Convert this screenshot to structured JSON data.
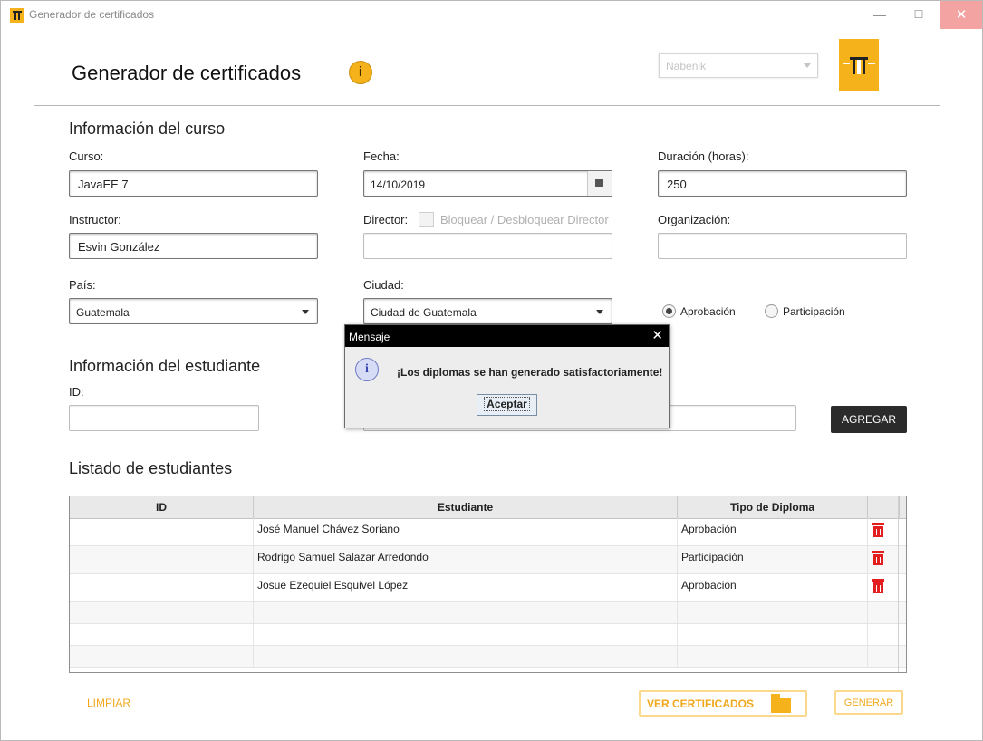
{
  "window": {
    "title": "Generador de certificados",
    "minimize": "—",
    "maximize": "☐",
    "close": "✕"
  },
  "header": {
    "title": "Generador de certificados",
    "info_icon": "i",
    "org_select_placeholder": "Nabenik",
    "brand_logo": "nabenik-logo"
  },
  "curso_section": {
    "title": "Información del curso",
    "curso_label": "Curso:",
    "curso_value": "JavaEE 7",
    "fecha_label": "Fecha:",
    "fecha_value": "14/10/2019",
    "duracion_label": "Duración (horas):",
    "duracion_value": "250",
    "instructor_label": "Instructor:",
    "instructor_value": "Esvin González",
    "director_label": "Director:",
    "director_toggle_label": "Bloquear / Desbloquear Director",
    "director_value": "",
    "organizacion_label": "Organización:",
    "organizacion_value": "",
    "pais_label": "País:",
    "pais_value": "Guatemala",
    "ciudad_label": "Ciudad:",
    "ciudad_value": "Ciudad de Guatemala",
    "diploma_options": [
      {
        "label": "Aprobación",
        "selected": true
      },
      {
        "label": "Participación",
        "selected": false
      }
    ]
  },
  "estudiante_section": {
    "title": "Información del estudiante",
    "id_label": "ID:",
    "id_value": "",
    "nombre_value": "",
    "agregar_label": "AGREGAR"
  },
  "listado": {
    "title": "Listado de estudiantes",
    "columns": [
      "ID",
      "Estudiante",
      "Tipo de Diploma"
    ],
    "rows": [
      {
        "id": "",
        "estudiante": "José Manuel Chávez Soriano",
        "tipo": "Aprobación"
      },
      {
        "id": "",
        "estudiante": "Rodrigo Samuel Salazar Arredondo",
        "tipo": "Participación"
      },
      {
        "id": "",
        "estudiante": "Josué Ezequiel Esquivel López",
        "tipo": "Aprobación"
      }
    ]
  },
  "footer": {
    "limpiar_label": "LIMPIAR",
    "ver_certificados_label": "VER CERTIFICADOS",
    "generar_label": "GENERAR"
  },
  "dialog": {
    "title": "Mensaje",
    "close": "✕",
    "icon": "i",
    "message": "¡Los diplomas se han generado satisfactoriamente!",
    "button": "Aceptar"
  },
  "colors": {
    "accent": "#f6b21a",
    "delete": "#e31e1e",
    "dark_button": "#2b2b2b"
  }
}
